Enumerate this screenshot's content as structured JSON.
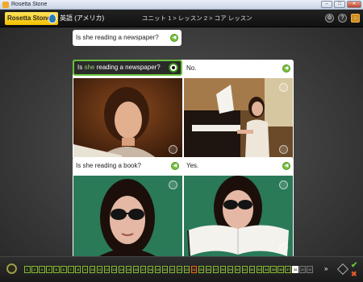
{
  "window": {
    "title": "Rosetta Stone",
    "buttons": [
      "–",
      "□",
      "✕"
    ]
  },
  "header": {
    "logo_text": "Rosetta Stone",
    "language": "英語 (アメリカ)",
    "breadcrumb": "ユニット 1 > レッスン 2 > コア レッスン",
    "icons": [
      "sound-settings-icon",
      "help-icon",
      "home-icon"
    ],
    "icon_glyphs": [
      "⚙",
      "?",
      "⌂"
    ]
  },
  "prompt": {
    "text": "Is she reading a newspaper?"
  },
  "answer_bar": {
    "prefix": "Is ",
    "highlight": "she",
    "suffix": " reading a newspaper?"
  },
  "panels": [
    {
      "id": "top",
      "left_caption": "",
      "right_caption": "No.",
      "photos": [
        "woman-reading-newspaper",
        "woman-playing-piano"
      ]
    },
    {
      "id": "bottom",
      "left_caption": "Is she reading a book?",
      "right_caption": "Yes.",
      "photos": [
        "woman-sunglasses-portrait",
        "woman-sunglasses-reading-book"
      ]
    }
  ],
  "bottom_bar": {
    "steps": [
      "1",
      "2",
      "3",
      "4",
      "5",
      "6",
      "7",
      "8",
      "9",
      "10",
      "11",
      "12",
      "13",
      "14",
      "15",
      "16",
      "17",
      "18",
      "19",
      "20",
      "21",
      "22",
      "23",
      "24",
      "25",
      "26",
      "27",
      "28",
      "29",
      "30",
      "31",
      "32",
      "33",
      "34",
      "35",
      "36",
      "37",
      "38",
      "39",
      "40"
    ],
    "current_step": "38",
    "wrong_step": "24",
    "next_glyph": "»",
    "check_glyph": "✔",
    "cross_glyph": "✖"
  },
  "colors": {
    "accent_green": "#6abf3a",
    "logo_yellow": "#f3c100",
    "wrong_orange": "#e66a1a"
  }
}
